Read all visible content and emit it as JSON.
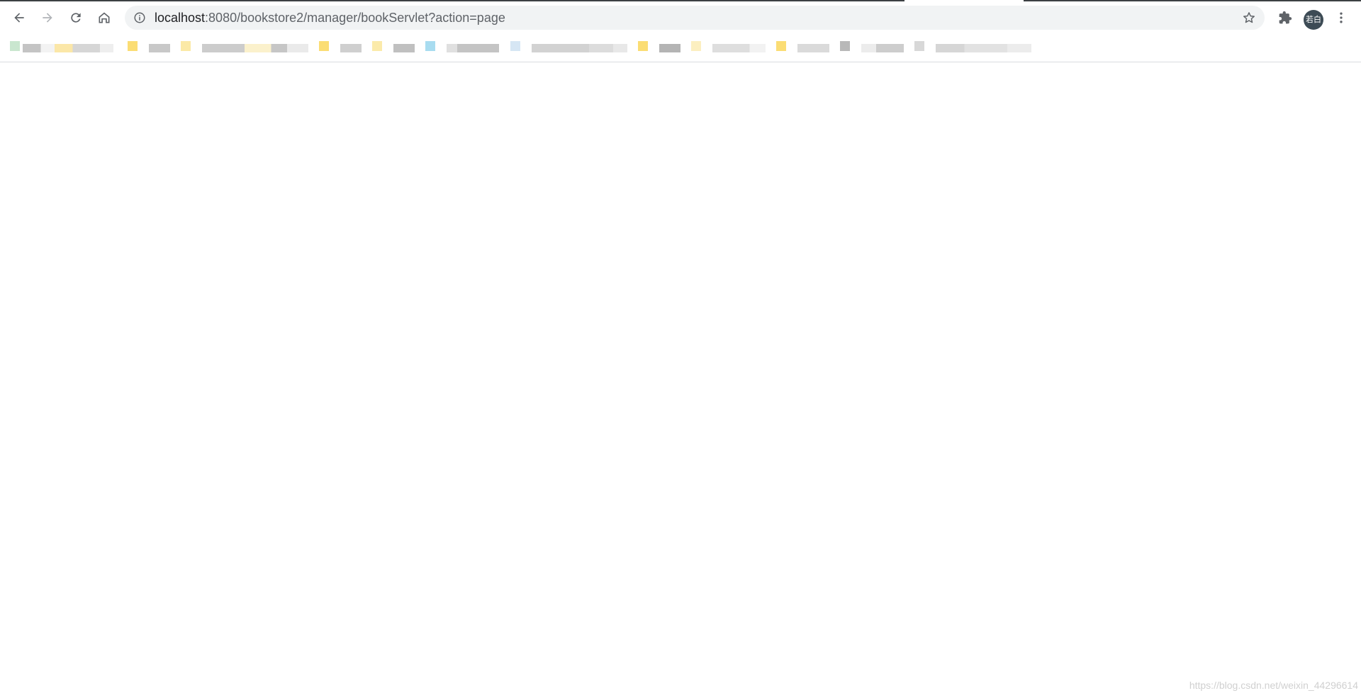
{
  "toolbar": {
    "back_icon": "arrow-left-icon",
    "forward_icon": "arrow-right-icon",
    "reload_icon": "reload-icon",
    "home_icon": "home-icon",
    "info_icon": "info-icon",
    "star_icon": "star-icon",
    "extensions_icon": "puzzle-icon",
    "menu_icon": "kebab-menu-icon"
  },
  "omnibox": {
    "host": "localhost",
    "rest": ":8080/bookstore2/manager/bookServlet?action=page"
  },
  "profile": {
    "avatar_text": "若白",
    "avatar_color": "#3d4b55"
  },
  "watermark": "https://blog.csdn.net/weixin_44296614",
  "colors": {
    "omnibox_bg": "#f1f3f4",
    "icon": "#5f6368"
  }
}
